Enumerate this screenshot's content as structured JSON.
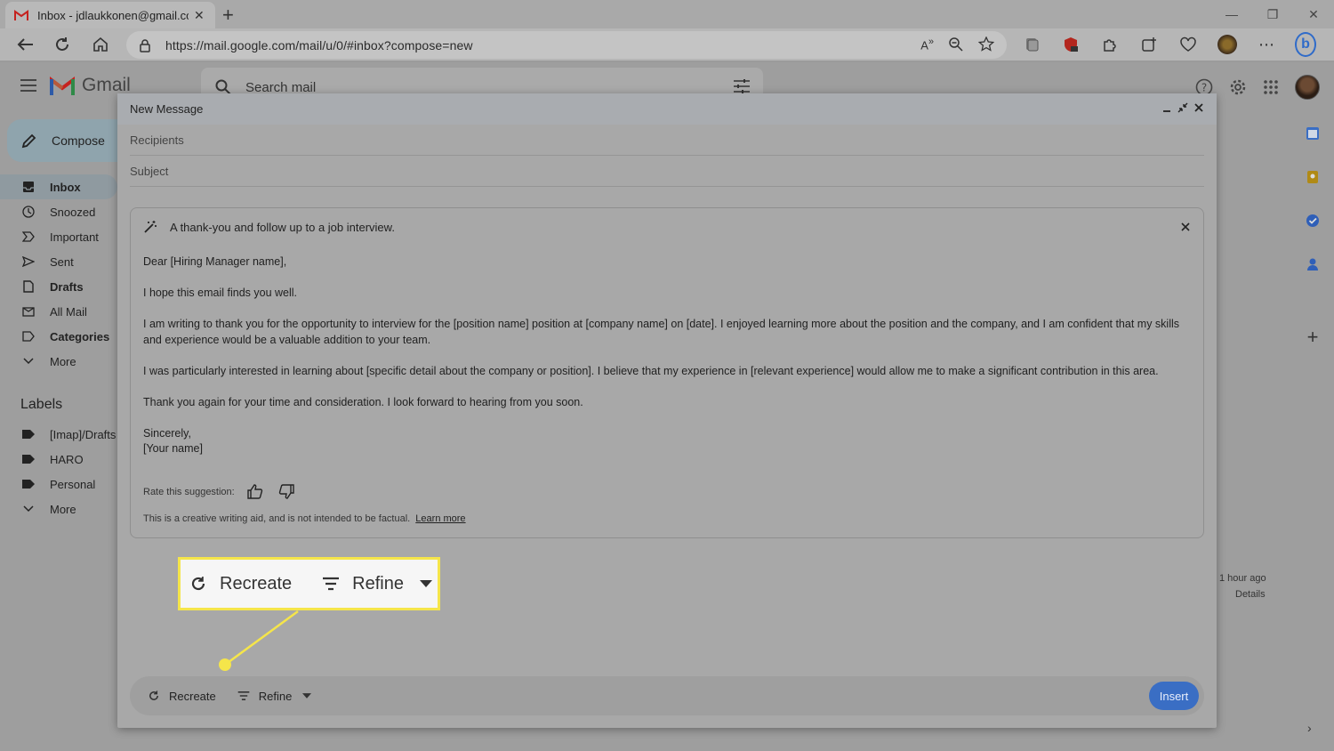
{
  "browser": {
    "tab_title": "Inbox - jdlaukkonen@gmail.com",
    "url": "https://mail.google.com/mail/u/0/#inbox?compose=new"
  },
  "gmail": {
    "app_name": "Gmail",
    "search_placeholder": "Search mail",
    "compose_label": "Compose",
    "nav": [
      {
        "label": "Inbox",
        "icon": "inbox-icon"
      },
      {
        "label": "Snoozed",
        "icon": "clock-icon"
      },
      {
        "label": "Important",
        "icon": "important-icon"
      },
      {
        "label": "Sent",
        "icon": "send-icon"
      },
      {
        "label": "Drafts",
        "icon": "file-icon"
      },
      {
        "label": "All Mail",
        "icon": "mail-stack-icon"
      },
      {
        "label": "Categories",
        "icon": "label-icon"
      },
      {
        "label": "More",
        "icon": "chevron-down-icon"
      }
    ],
    "labels_title": "Labels",
    "labels": [
      {
        "label": "[Imap]/Drafts"
      },
      {
        "label": "HARO"
      },
      {
        "label": "Personal"
      },
      {
        "label": "More"
      }
    ],
    "bg_time": "1 hour ago",
    "bg_details": "Details"
  },
  "compose": {
    "title": "New Message",
    "recipients_placeholder": "Recipients",
    "subject_placeholder": "Subject",
    "prompt": "A thank-you and follow up to a job interview.",
    "body": [
      "Dear [Hiring Manager name],",
      "I hope this email finds you well.",
      "I am writing to thank you for the opportunity to interview for the [position name] position at [company name] on [date]. I enjoyed learning more about the position and the company, and I am confident that my skills and experience would be a valuable addition to your team.",
      "I was particularly interested in learning about [specific detail about the company or position]. I believe that my experience in [relevant experience] would allow me to make a significant contribution in this area.",
      "Thank you again for your time and consideration. I look forward to hearing from you soon."
    ],
    "signoff": "Sincerely,",
    "signature": "[Your name]",
    "rate_label": "Rate this suggestion:",
    "disclaimer": "This is a creative writing aid, and is not intended to be factual.",
    "learn_more": "Learn more",
    "recreate_label": "Recreate",
    "refine_label": "Refine",
    "insert_label": "Insert"
  },
  "colors": {
    "callout_border": "#f5e54a",
    "insert_button": "#3a6ec4"
  }
}
